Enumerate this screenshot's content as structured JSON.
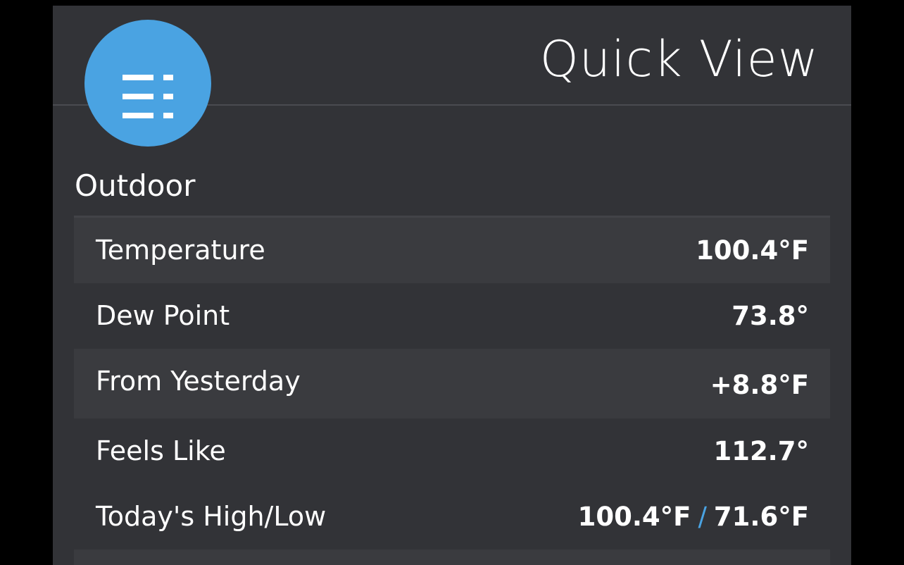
{
  "header": {
    "title": "Quick View",
    "menu_icon": "list-menu-icon",
    "accent_color": "#4aa3e2"
  },
  "section": {
    "title": "Outdoor"
  },
  "rows": [
    {
      "label": "Temperature",
      "value": "100.4°F"
    },
    {
      "label": "Dew Point",
      "value": "73.8°"
    },
    {
      "label": "From Yesterday",
      "value": "+8.8°F"
    },
    {
      "label": "Feels Like",
      "value": "112.7°"
    },
    {
      "label": "Today's High/Low",
      "high": "100.4°F",
      "separator": "/",
      "low": "71.6°F"
    }
  ]
}
